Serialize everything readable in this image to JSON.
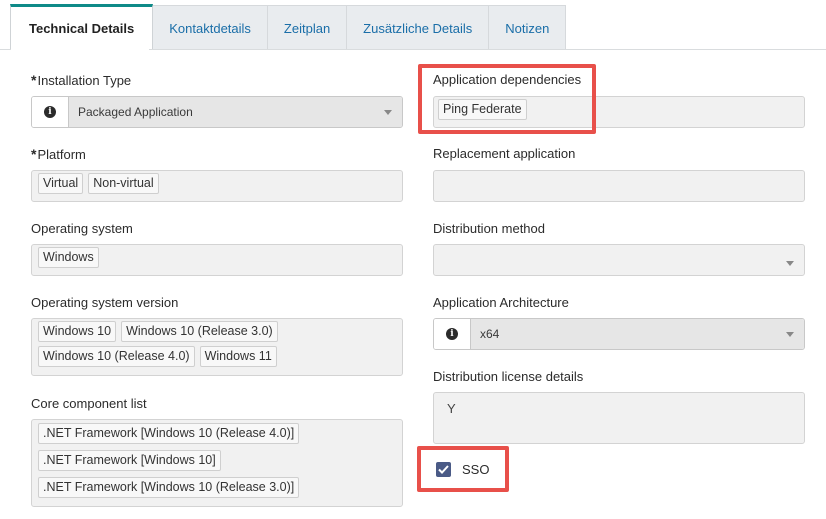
{
  "tabs": [
    {
      "label": "Technical Details",
      "active": true
    },
    {
      "label": "Kontaktdetails"
    },
    {
      "label": "Zeitplan"
    },
    {
      "label": "Zusätzliche Details"
    },
    {
      "label": "Notizen"
    }
  ],
  "left": {
    "installation_type": {
      "required_mark": "*",
      "label": "Installation Type",
      "value": "Packaged Application",
      "icon": "info-icon"
    },
    "platform": {
      "required_mark": "*",
      "label": "Platform",
      "values": [
        "Virtual",
        "Non-virtual"
      ]
    },
    "operating_system": {
      "label": "Operating system",
      "values": [
        "Windows"
      ]
    },
    "os_version": {
      "label": "Operating system version",
      "values": [
        "Windows 10",
        "Windows 10 (Release 3.0)",
        "Windows 10 (Release 4.0)",
        "Windows 11"
      ]
    },
    "core_components": {
      "label": "Core component list",
      "values": [
        ".NET Framework [Windows 10 (Release 4.0)]",
        ".NET Framework [Windows 10]",
        ".NET Framework [Windows 10 (Release 3.0)]"
      ]
    }
  },
  "right": {
    "app_dependencies": {
      "label": "Application dependencies",
      "values": [
        "Ping Federate"
      ]
    },
    "replacement_app": {
      "label": "Replacement application",
      "values": []
    },
    "distribution_method": {
      "label": "Distribution method",
      "value": ""
    },
    "app_architecture": {
      "label": "Application Architecture",
      "value": "x64",
      "icon": "info-icon"
    },
    "license_details": {
      "label": "Distribution license details",
      "value": "Y"
    },
    "sso": {
      "label": "SSO",
      "checked": true
    }
  },
  "colors": {
    "highlight": "#e8504a",
    "tab_accent": "#0e8a88",
    "tab_link": "#1a6ea8",
    "checkbox": "#4a5a86"
  }
}
